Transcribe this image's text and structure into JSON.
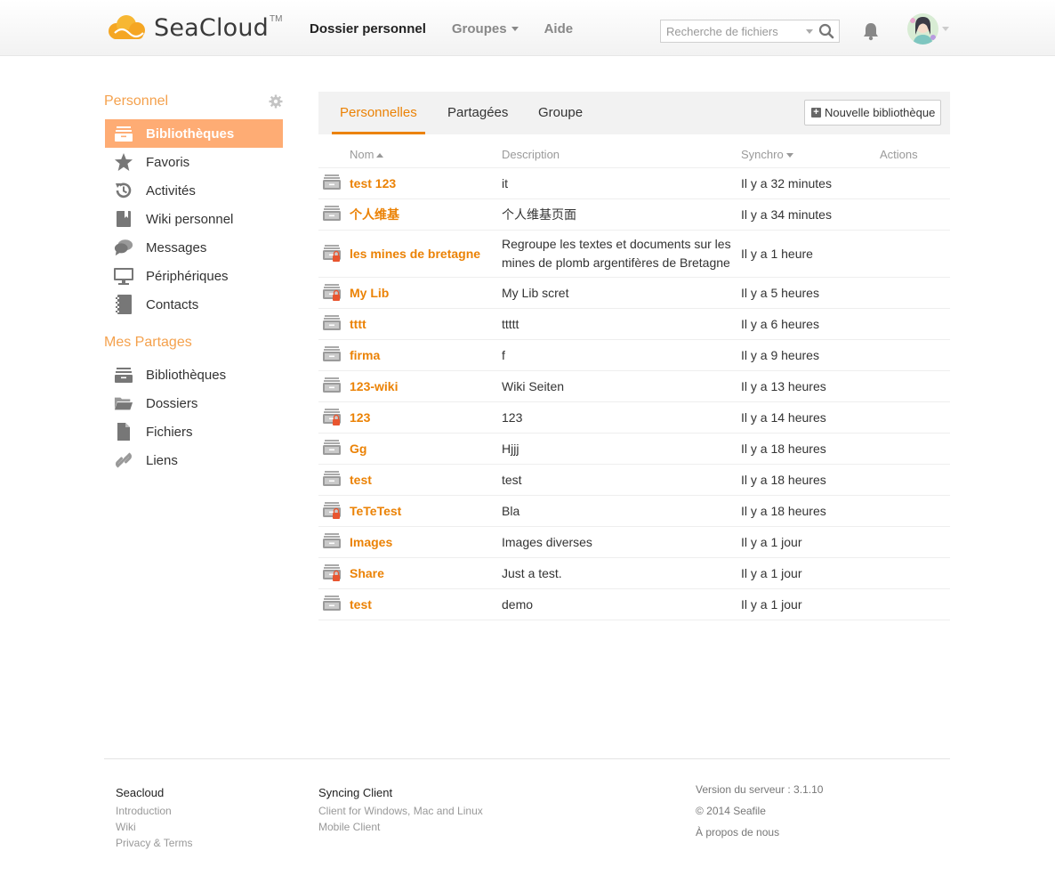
{
  "header": {
    "brand": "SeaCloud",
    "brand_tm": "TM",
    "nav": [
      {
        "label": "Dossier personnel",
        "active": true
      },
      {
        "label": "Groupes",
        "dropdown": true
      },
      {
        "label": "Aide"
      }
    ],
    "search_placeholder": "Recherche de fichiers"
  },
  "sidebar": {
    "personal_title": "Personnel",
    "personal_items": [
      {
        "label": "Bibliothèques",
        "icon": "library-icon",
        "active": true
      },
      {
        "label": "Favoris",
        "icon": "star-icon"
      },
      {
        "label": "Activités",
        "icon": "history-icon"
      },
      {
        "label": "Wiki personnel",
        "icon": "wiki-icon"
      },
      {
        "label": "Messages",
        "icon": "messages-icon"
      },
      {
        "label": "Périphériques",
        "icon": "monitor-icon"
      },
      {
        "label": "Contacts",
        "icon": "contacts-icon"
      }
    ],
    "shares_title": "Mes Partages",
    "share_items": [
      {
        "label": "Bibliothèques",
        "icon": "library-icon"
      },
      {
        "label": "Dossiers",
        "icon": "folder-icon"
      },
      {
        "label": "Fichiers",
        "icon": "file-icon"
      },
      {
        "label": "Liens",
        "icon": "link-icon"
      }
    ]
  },
  "main": {
    "tabs": [
      "Personnelles",
      "Partagées",
      "Groupe"
    ],
    "new_library_label": "Nouvelle bibliothèque",
    "columns": {
      "name": "Nom",
      "description": "Description",
      "sync": "Synchro",
      "actions": "Actions"
    },
    "libraries": [
      {
        "name": "test 123",
        "description": "it",
        "sync": "Il y a 32 minutes",
        "encrypted": false
      },
      {
        "name": "个人维基",
        "description": "个人维基页面",
        "sync": "Il y a 34 minutes",
        "encrypted": false
      },
      {
        "name": "les mines de bretagne",
        "description": "Regroupe les textes et documents sur les mines de plomb argentifères de Bretagne",
        "sync": "Il y a 1 heure",
        "encrypted": true
      },
      {
        "name": "My Lib",
        "description": "My Lib scret",
        "sync": "Il y a 5 heures",
        "encrypted": true
      },
      {
        "name": "tttt",
        "description": "ttttt",
        "sync": "Il y a 6 heures",
        "encrypted": false
      },
      {
        "name": "firma",
        "description": "f",
        "sync": "Il y a 9 heures",
        "encrypted": false
      },
      {
        "name": "123-wiki",
        "description": "Wiki Seiten",
        "sync": "Il y a 13 heures",
        "encrypted": false
      },
      {
        "name": "123",
        "description": "123",
        "sync": "Il y a 14 heures",
        "encrypted": true
      },
      {
        "name": "Gg",
        "description": "Hjjj",
        "sync": "Il y a 18 heures",
        "encrypted": false
      },
      {
        "name": "test",
        "description": "test",
        "sync": "Il y a 18 heures",
        "encrypted": false
      },
      {
        "name": "TeTeTest",
        "description": "Bla",
        "sync": "Il y a 18 heures",
        "encrypted": true
      },
      {
        "name": "Images",
        "description": "Images diverses",
        "sync": "Il y a 1 jour",
        "encrypted": false
      },
      {
        "name": "Share",
        "description": "Just a test.",
        "sync": "Il y a 1 jour",
        "encrypted": true
      },
      {
        "name": "test",
        "description": "demo",
        "sync": "Il y a 1 jour",
        "encrypted": false
      }
    ]
  },
  "footer": {
    "col1": {
      "title": "Seacloud",
      "links": [
        "Introduction",
        "Wiki",
        "Privacy & Terms"
      ]
    },
    "col2": {
      "title": "Syncing Client",
      "links": [
        "Client for Windows, Mac and Linux",
        "Mobile Client"
      ]
    },
    "server_version": "Version du serveur : 3.1.10",
    "copyright": "© 2014 Seafile",
    "about": "À propos de nous"
  },
  "colors": {
    "accent": "#eb8205",
    "sidebar_active": "#feac74",
    "section_title": "#f4a14d"
  }
}
